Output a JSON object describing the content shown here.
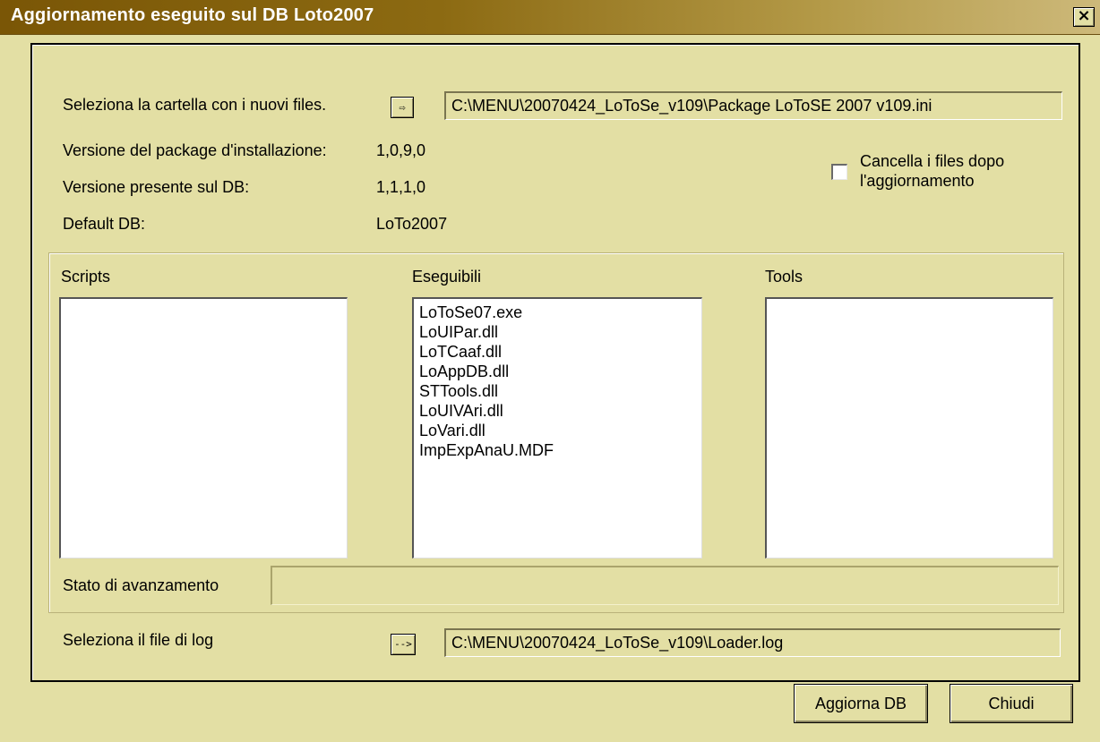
{
  "window": {
    "title": "Aggiornamento eseguito sul DB Loto2007",
    "close_label": "×"
  },
  "folder": {
    "label": "Seleziona la cartella con i nuovi files.",
    "browse_label": "⇨",
    "path": "C:\\MENU\\20070424_LoToSe_v109\\Package LoToSE 2007 v109.ini"
  },
  "info": [
    {
      "label": "Versione del package d'installazione:",
      "value": "1,0,9,0"
    },
    {
      "label": "Versione presente sul DB:",
      "value": "1,1,1,0"
    },
    {
      "label": "Default DB:",
      "value": "LoTo2007"
    }
  ],
  "delete_files": {
    "label_line1": "Cancella i files dopo",
    "label_line2": "l'aggiornamento",
    "checked": false
  },
  "lists": {
    "scripts": {
      "header": "Scripts",
      "items": []
    },
    "eseguibili": {
      "header": "Eseguibili",
      "items": [
        "LoToSe07.exe",
        "LoUIPar.dll",
        "LoTCaaf.dll",
        "LoAppDB.dll",
        "STTools.dll",
        "LoUIVAri.dll",
        "LoVari.dll",
        "ImpExpAnaU.MDF"
      ]
    },
    "tools": {
      "header": "Tools",
      "items": []
    }
  },
  "progress": {
    "label": "Stato di avanzamento",
    "value": 0
  },
  "log": {
    "label": "Seleziona il file di log",
    "browse_label": "-->",
    "path": "C:\\MENU\\20070424_LoToSe_v109\\Loader.log"
  },
  "buttons": {
    "update": "Aggiorna DB",
    "close": "Chiudi"
  }
}
